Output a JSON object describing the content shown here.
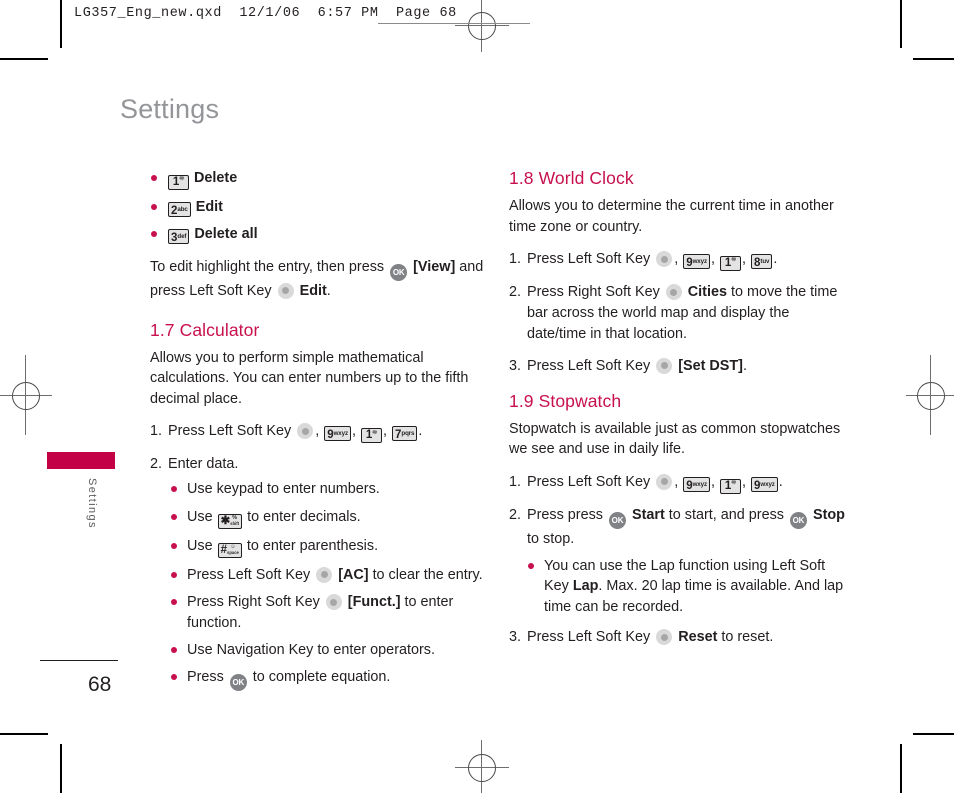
{
  "print": {
    "header_text": "LG357_Eng_new.qxd  12/1/06  6:57 PM  Page 68"
  },
  "page": {
    "title": "Settings",
    "side_tab_label": "Settings",
    "folio": "68",
    "accent_color": "#c8104c",
    "tab_color": "#c30045",
    "title_color": "#939598"
  },
  "left_column": {
    "menu_items": [
      {
        "key": {
          "digit": "1",
          "sub": "⚙"
        },
        "label": "Delete"
      },
      {
        "key": {
          "digit": "2",
          "sup": "abc"
        },
        "label": "Edit"
      },
      {
        "key": {
          "digit": "3",
          "sup": "def"
        },
        "label": "Delete all"
      }
    ],
    "edit_note_1": "To edit highlight the entry, then press",
    "edit_note_view": "[View]",
    "edit_note_2": "and press Left Soft Key",
    "edit_note_edit": "Edit",
    "edit_note_end": ".",
    "calculator": {
      "heading": "1.7 Calculator",
      "intro": "Allows you to perform simple mathematical calculations. You can enter numbers up to the fifth decimal place.",
      "step1_num": "1.",
      "step1_text": "Press Left Soft Key",
      "step1_keys": [
        {
          "digit": "9",
          "sup": "wxyz"
        },
        {
          "digit": "1",
          "sub": "⚙"
        },
        {
          "digit": "7",
          "sup": "pqrs"
        }
      ],
      "step2_num": "2.",
      "step2_text": "Enter data.",
      "bullets": [
        {
          "text_before": "Use keypad to enter numbers.",
          "type": "plain"
        },
        {
          "text_before": "Use",
          "type": "key-star",
          "text_after": "to enter decimals."
        },
        {
          "text_before": "Use",
          "type": "key-hash",
          "text_after": "to enter parenthesis."
        },
        {
          "text_before": "Press Left Soft Key",
          "type": "softkey",
          "bold": "[AC]",
          "text_after": "to clear the entry."
        },
        {
          "text_before": "Press Right Soft Key",
          "type": "softkey",
          "bold": "[Funct.]",
          "text_after": "to enter function."
        },
        {
          "text_before": "Use Navigation Key to enter operators.",
          "type": "plain"
        },
        {
          "text_before": "Press",
          "type": "ok",
          "text_after": "to complete equation."
        }
      ]
    }
  },
  "right_column": {
    "world_clock": {
      "heading": "1.8 World Clock",
      "intro": "Allows you to determine the current time in another time zone or country.",
      "step1_num": "1.",
      "step1_text": "Press Left Soft Key",
      "step1_keys": [
        {
          "digit": "9",
          "sup": "wxyz"
        },
        {
          "digit": "1",
          "sub": "⚙"
        },
        {
          "digit": "8",
          "sup": "tuv"
        }
      ],
      "step2_num": "2.",
      "step2_before": "Press Right Soft Key",
      "step2_bold": "Cities",
      "step2_after": "to move the time bar across the world map and display the date/time in that location.",
      "step3_num": "3.",
      "step3_before": "Press Left Soft Key",
      "step3_bold": "[Set DST]",
      "step3_after": "."
    },
    "stopwatch": {
      "heading": "1.9 Stopwatch",
      "intro": "Stopwatch is available just as common stopwatches we see and use in daily life.",
      "step1_num": "1.",
      "step1_text": "Press Left Soft Key",
      "step1_keys": [
        {
          "digit": "9",
          "sup": "wxyz"
        },
        {
          "digit": "1",
          "sub": "⚙"
        },
        {
          "digit": "9",
          "sup": "wxyz"
        }
      ],
      "step2_num": "2.",
      "step2_a": "Press press",
      "step2_bold1": "Start",
      "step2_b": "to start, and press",
      "step2_bold2": "Stop",
      "step2_c": "to stop.",
      "bullet_a": "You can use the Lap function using Left Soft Key",
      "bullet_bold": "Lap",
      "bullet_b": ". Max. 20 lap time is available. And lap time can be recorded.",
      "step3_num": "3.",
      "step3_before": "Press Left Soft Key",
      "step3_bold": "Reset",
      "step3_after": "to reset."
    }
  }
}
